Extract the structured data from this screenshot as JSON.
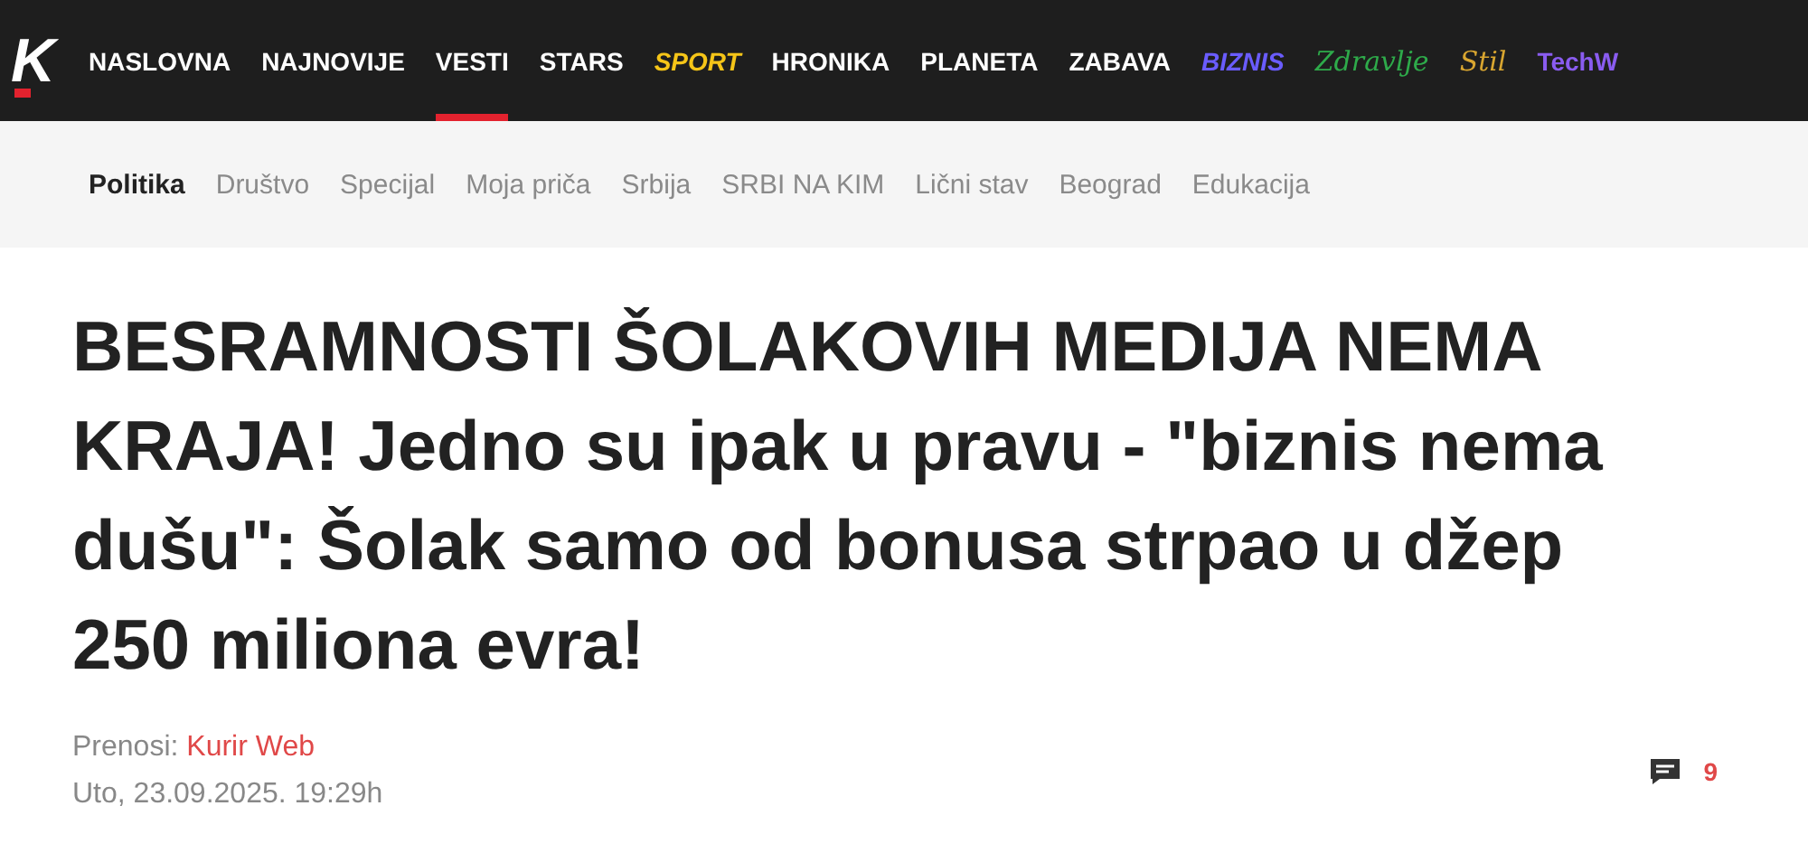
{
  "logo": {
    "letter": "K"
  },
  "nav": [
    {
      "label": "NASLOVNA",
      "selected": false,
      "kind": "plain",
      "color": "#ffffff"
    },
    {
      "label": "NAJNOVIJE",
      "selected": false,
      "kind": "plain",
      "color": "#ffffff"
    },
    {
      "label": "VESTI",
      "selected": true,
      "kind": "plain",
      "color": "#ffffff"
    },
    {
      "label": "STARS",
      "selected": false,
      "kind": "plain",
      "color": "#ffffff"
    },
    {
      "label": "SPORT",
      "selected": false,
      "kind": "italic",
      "color": "#f5c518"
    },
    {
      "label": "HRONIKA",
      "selected": false,
      "kind": "plain",
      "color": "#ffffff"
    },
    {
      "label": "PLANETA",
      "selected": false,
      "kind": "plain",
      "color": "#ffffff"
    },
    {
      "label": "ZABAVA",
      "selected": false,
      "kind": "plain",
      "color": "#ffffff"
    },
    {
      "label": "BIZNIS",
      "selected": false,
      "kind": "italic",
      "color": "#6a5cff"
    },
    {
      "label": "Zdravlje",
      "selected": false,
      "kind": "script",
      "color": "#2eaa4a"
    },
    {
      "label": "Stil",
      "selected": false,
      "kind": "script",
      "color": "#d9a630"
    },
    {
      "label": "TechW",
      "selected": false,
      "kind": "plain",
      "color": "#8a5cf0"
    }
  ],
  "subnav": [
    {
      "label": "Politika",
      "selected": true
    },
    {
      "label": "Društvo",
      "selected": false
    },
    {
      "label": "Specijal",
      "selected": false
    },
    {
      "label": "Moja priča",
      "selected": false
    },
    {
      "label": "Srbija",
      "selected": false
    },
    {
      "label": "SRBI NA KIM",
      "selected": false
    },
    {
      "label": "Lični stav",
      "selected": false
    },
    {
      "label": "Beograd",
      "selected": false
    },
    {
      "label": "Edukacija",
      "selected": false
    }
  ],
  "headline": "BESRAMNOSTI ŠOLAKOVIH MEDIJA NEMA KRAJA! Jedno su ipak u pravu - \"biznis nema dušu\": Šolak samo od bonusa strpao u džep 250 miliona evra!",
  "meta": {
    "source_label": "Prenosi:",
    "source": "Kurir Web",
    "date": "Uto, 23.09.2025. 19:29h",
    "comments": "9"
  }
}
